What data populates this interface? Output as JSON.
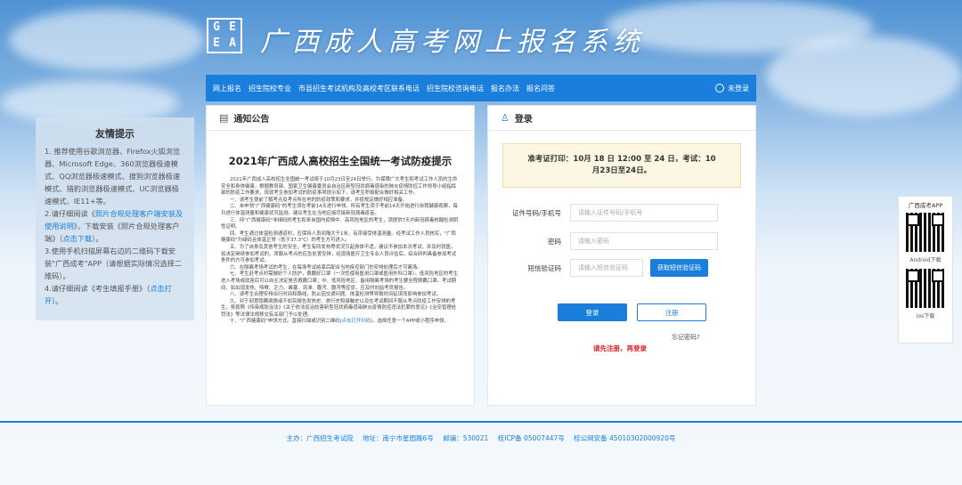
{
  "header": {
    "logo_letters": [
      "G",
      "E",
      "E",
      "A"
    ],
    "title": "广西成人高考网上报名系统"
  },
  "nav": {
    "items": [
      "网上报名",
      "招生院校专业",
      "市县招生考试机构及高校考区联系电话",
      "招生院校咨询电话",
      "报名办法",
      "报名问答"
    ],
    "login_label": "未登录"
  },
  "tips": {
    "title": "友情提示",
    "line1": "1. 推荐使用谷歌浏览器、Firefox火狐浏览器、Microsoft Edge、360浏览器极速模式、QQ浏览器极速模式、搜狗浏览器极速模式、猎豹浏览器极速模式、UC浏览器极速模式、IE11+等。",
    "line2_pre": "2.请仔细阅读《",
    "line2_link1": "照片合规处理客户端安装及使用说明",
    "line2_mid": "》，下载安装《照片合规处理客户端》（",
    "line2_link2": "点击下载",
    "line2_post": "）。",
    "line3": "3.使用手机扫描屏幕右边的二维码下载安装\"广西成考\"APP（请根据实际情况选择二维码）。",
    "line4_pre": "4.请仔细阅读《考生填报手册》（",
    "line4_link": "点击打开",
    "line4_post": "）。"
  },
  "notice": {
    "head": "通知公告",
    "title": "2021年广西成人高校招生全国统一考试防疫提示",
    "paragraphs": [
      "2021年广西成人高校招生全国统一考试将于10月23日至24日举行。为保障广大考生和考试工作人员的生命安全和身体健康，根据教育部、国家卫生健康委员会自治区新型冠状病毒感染的肺炎疫情防控工作领导小组指挥部的防疫工作要求，现就考生参加考试的防疫事项提示如下，请考生积极配合做好相关工作。",
      "一、请考生提前了解考点及考点所在地的防疫政策和要求，并按规定做好相应准备。",
      "二、未申领\"广西健康码\"的考生须在考前14天进行申领。所有考生须于考前14天开始进行自我健康观察，每日进行体温测量和健康状况监测。建议考生在当地应接尽接新冠病毒疫苗。",
      "三、持\"广西健康码\"非绿码的考生和来自国内疫情中、高风险地区的考生，须提供7天内新冠病毒核酸检测阴性证明。",
      "四、考生通过体温检测通道时，应保持人员间隔大于1米，有序接受体温测量。经考试工作人员核实，\"广西健康码\"为绿码且体温正常（低于37.3℃）的考生方可进入。",
      "五、为了自身及其他考生的安全，考生有同发热等状况引起身体不适，建议不参加本次考试，并及时就医。如决定继续参加考试的，须服从考点的应急处置安排，经现场医疗卫生专业人员评估后，综合研判具备参加考试条件的方可参加考试。",
      "六、在隔离考场考试的考生，在每场考试结束后配合当地疾控部门的安排处理后才可离场。",
      "七、考生赴考点时需做好个人防护，佩戴好口罩（一次性使用医用口罩或医用外科口罩）。低风险地区的考生进入考场或就座后可以自主决定是否佩戴口罩；中、低风险地区、备用隔离考场的考生要全程佩戴口罩。考试期间，如出现发热、咳嗽、乏力、鼻塞、流涕、腹泻、腹泻等症状，应及时向监考员报告。",
      "八、请考生合理安排出行时间和路线，防止因交通问题、体温检测等导致时间延误而影响参加考试。",
      "九、对于刻意隐瞒病情或不如实报告发热史、旅行史和接触史以及在考试期间不服从考点防疫工作安排的考生，将按照《传染病防治法》《关于依法惩治妨害新型冠状病毒感染肺炎疫情防控违法犯罪的意见》《治安管理处罚法》等法律法规移交有关部门予以处理。",
      "十、\"广西健康码\"申领方式。直接扫描或识别二维码(",
      "点击打开扫码",
      ")，选择任意一个APP或小程序申领。"
    ]
  },
  "login": {
    "head": "登录",
    "admit_notice": "准考证打印：10月 18 日 12:00 至 24 日，考试：10月23日至24日。",
    "id_label": "证件号码/手机号",
    "id_placeholder": "请输入证件号码/手机号",
    "pwd_label": "密码",
    "pwd_placeholder": "请输入密码",
    "sms_label": "短信验证码",
    "sms_placeholder": "请输入短信验证码",
    "sms_button": "获取短信验证码",
    "login_button": "登录",
    "register_button": "注册",
    "forgot": "忘记密码?",
    "must_register": "请先注册，再登录"
  },
  "app": {
    "title": "广西成考APP",
    "android": "Android下载",
    "ios": "ios下载"
  },
  "footer": {
    "host": "主办：广西招生考试院",
    "address": "地址：南宁市星园路6号",
    "postcode": "邮编：530021",
    "icp": "桂ICP备 05007447号",
    "police": "桂公网安备 45010302000920号"
  },
  "colors": {
    "brand": "#1a7fdc",
    "warning": "#e02020"
  }
}
